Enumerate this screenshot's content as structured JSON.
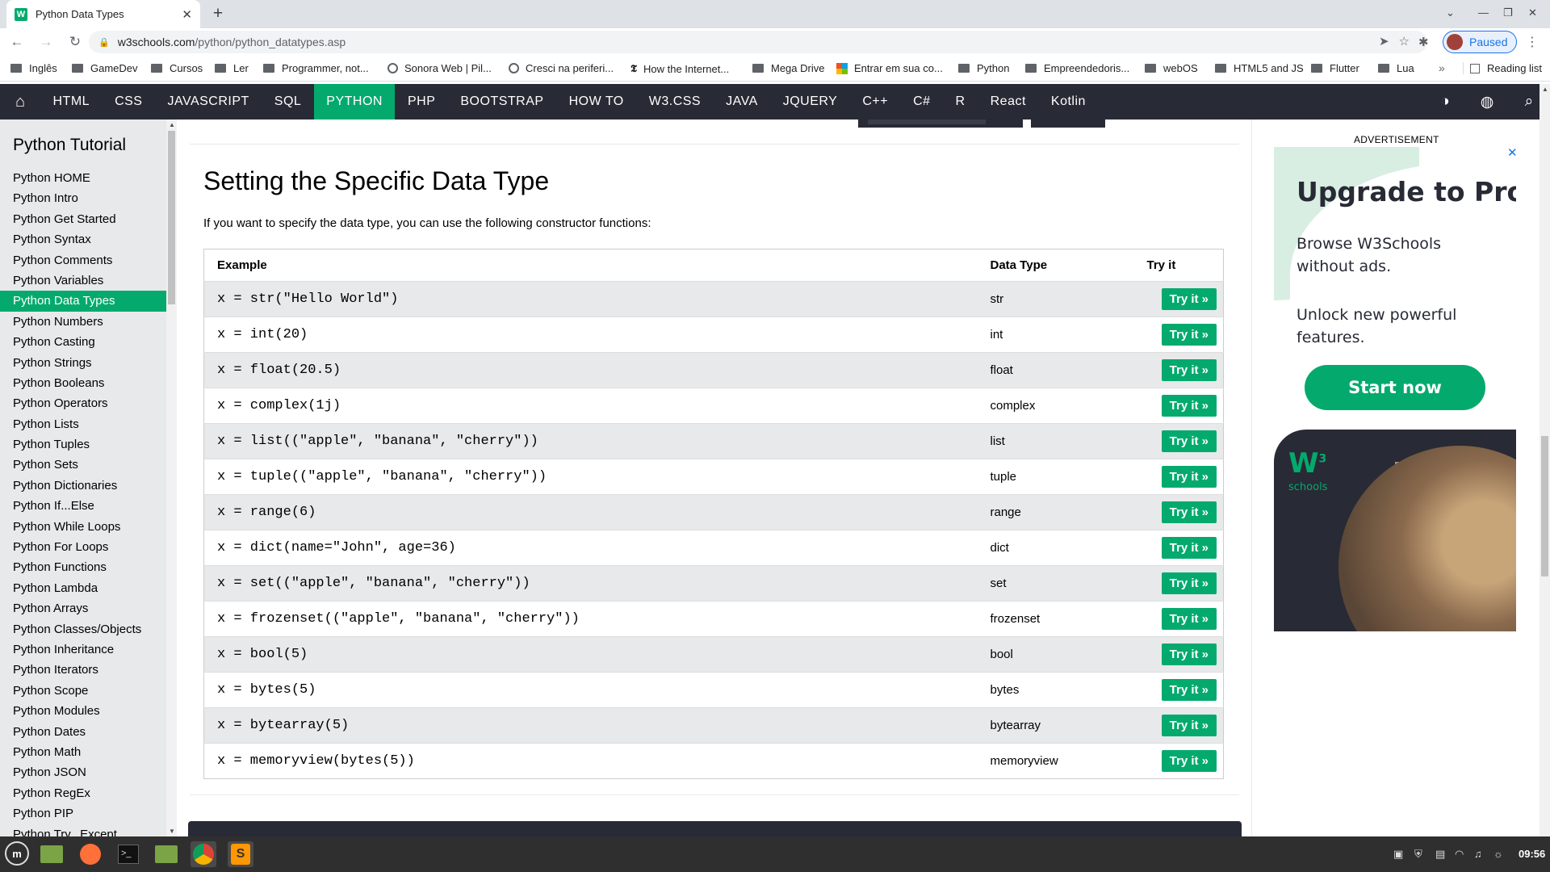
{
  "browser": {
    "tab_title": "Python Data Types",
    "tab_favicon": "W",
    "new_tab_icon": "+",
    "url_host": "w3schools.com",
    "url_path": "/python/python_datatypes.asp",
    "profile_status": "Paused",
    "bookmarks": [
      "Inglês",
      "GameDev",
      "Cursos",
      "Ler",
      "Programmer, not...",
      "Sonora Web | Pil...",
      "Cresci na periferi...",
      "How the Internet...",
      "Mega Drive",
      "Entrar em sua co...",
      "Python",
      "Empreendedoris...",
      "webOS",
      "HTML5 and JS",
      "Flutter",
      "Lua"
    ],
    "bookmarks_more": "»",
    "reading_list": "Reading list"
  },
  "topnav": {
    "items": [
      "HTML",
      "CSS",
      "JAVASCRIPT",
      "SQL",
      "PYTHON",
      "PHP",
      "BOOTSTRAP",
      "HOW TO",
      "W3.CSS",
      "JAVA",
      "JQUERY",
      "C++",
      "C#",
      "R",
      "React",
      "Kotlin"
    ],
    "active": "PYTHON"
  },
  "sidebar": {
    "title": "Python Tutorial",
    "items": [
      "Python HOME",
      "Python Intro",
      "Python Get Started",
      "Python Syntax",
      "Python Comments",
      "Python Variables",
      "Python Data Types",
      "Python Numbers",
      "Python Casting",
      "Python Strings",
      "Python Booleans",
      "Python Operators",
      "Python Lists",
      "Python Tuples",
      "Python Sets",
      "Python Dictionaries",
      "Python If...Else",
      "Python While Loops",
      "Python For Loops",
      "Python Functions",
      "Python Lambda",
      "Python Arrays",
      "Python Classes/Objects",
      "Python Inheritance",
      "Python Iterators",
      "Python Scope",
      "Python Modules",
      "Python Dates",
      "Python Math",
      "Python JSON",
      "Python RegEx",
      "Python PIP",
      "Python Try...Except"
    ],
    "active": "Python Data Types"
  },
  "main": {
    "heading": "Setting the Specific Data Type",
    "intro": "If you want to specify the data type, you can use the following constructor functions:",
    "table": {
      "headers": [
        "Example",
        "Data Type",
        "Try it"
      ],
      "button_label": "Try it »",
      "rows": [
        {
          "example": "x = str(\"Hello World\")",
          "type": "str"
        },
        {
          "example": "x = int(20)",
          "type": "int"
        },
        {
          "example": "x = float(20.5)",
          "type": "float"
        },
        {
          "example": "x = complex(1j)",
          "type": "complex"
        },
        {
          "example": "x = list((\"apple\", \"banana\", \"cherry\"))",
          "type": "list"
        },
        {
          "example": "x = tuple((\"apple\", \"banana\", \"cherry\"))",
          "type": "tuple"
        },
        {
          "example": "x = range(6)",
          "type": "range"
        },
        {
          "example": "x = dict(name=\"John\", age=36)",
          "type": "dict"
        },
        {
          "example": "x = set((\"apple\", \"banana\", \"cherry\"))",
          "type": "set"
        },
        {
          "example": "x = frozenset((\"apple\", \"banana\", \"cherry\"))",
          "type": "frozenset"
        },
        {
          "example": "x = bool(5)",
          "type": "bool"
        },
        {
          "example": "x = bytes(5)",
          "type": "bytes"
        },
        {
          "example": "x = bytearray(5)",
          "type": "bytearray"
        },
        {
          "example": "x = memoryview(bytes(5))",
          "type": "memoryview"
        }
      ]
    }
  },
  "ad": {
    "label": "ADVERTISEMENT",
    "close": "✕",
    "headline": "Upgrade to Pro",
    "line1": "Browse W3Schools without ads.",
    "line2": "Unlock new powerful features.",
    "cta": "Start now",
    "logo": "W",
    "logo_sup": "3",
    "logo_sub": "schools"
  },
  "taskbar": {
    "clock": "09:56"
  },
  "colors": {
    "accent": "#04aa6d",
    "nav_bg": "#282a35",
    "sidebar_bg": "#e7e9eb"
  }
}
